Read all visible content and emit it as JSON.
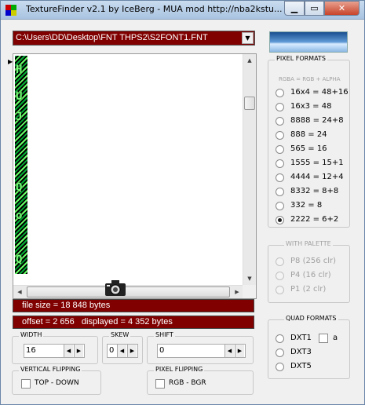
{
  "window": {
    "title": "TextureFinder v2.1 by IceBerg - MUA mod http://nba2kstu...",
    "min_symbol": "▁",
    "max_symbol": "▭",
    "close_symbol": "✕"
  },
  "path_combo": {
    "value": "C:\\Users\\DD\\Desktop\\FNT THPS2\\S2FONT1.FNT",
    "arrow": "▼"
  },
  "viewer": {
    "row_marker": "▶",
    "glyphs": [
      "H",
      "U",
      "J",
      "Q",
      "o",
      "Q"
    ],
    "scroll_up": "▲",
    "scroll_down": "▼",
    "scroll_left": "◀",
    "scroll_right": "▶"
  },
  "info": {
    "file_size": "file size = 18 848 bytes",
    "offset_displayed": "offset = 2 656   displayed = 4 352 bytes"
  },
  "width": {
    "label": "WIDTH",
    "value": "16"
  },
  "skew": {
    "label": "SKEW",
    "value": "0"
  },
  "shift": {
    "label": "SHIFT",
    "value": "0"
  },
  "spin_arrows": {
    "left": "◀",
    "right": "▶"
  },
  "vertical_flipping": {
    "label": "VERTICAL FLIPPING",
    "option": "TOP - DOWN",
    "checked": false
  },
  "pixel_flipping": {
    "label": "PIXEL FLIPPING",
    "option": "RGB  -  BGR",
    "checked": false
  },
  "pixel_formats": {
    "label": "PIXEL FORMATS",
    "subheader": "RGBA = RGB + ALPHA",
    "selected": "2222 = 6+2",
    "items": [
      "16x4 = 48+16",
      "16x3 = 48",
      "8888 = 24+8",
      "888 = 24",
      "565 = 16",
      "1555 = 15+1",
      "4444 = 12+4",
      "8332 = 8+8",
      "332 = 8",
      "2222 = 6+2"
    ]
  },
  "with_palette": {
    "label": "WITH PALETTE",
    "items": [
      "P8  (256 clr)",
      "P4  (16 clr)",
      "P1  (2 clr)"
    ]
  },
  "quad_formats": {
    "label": "QUAD FORMATS",
    "items": [
      "DXT1",
      "DXT3",
      "DXT5"
    ],
    "alpha_label": "a"
  }
}
